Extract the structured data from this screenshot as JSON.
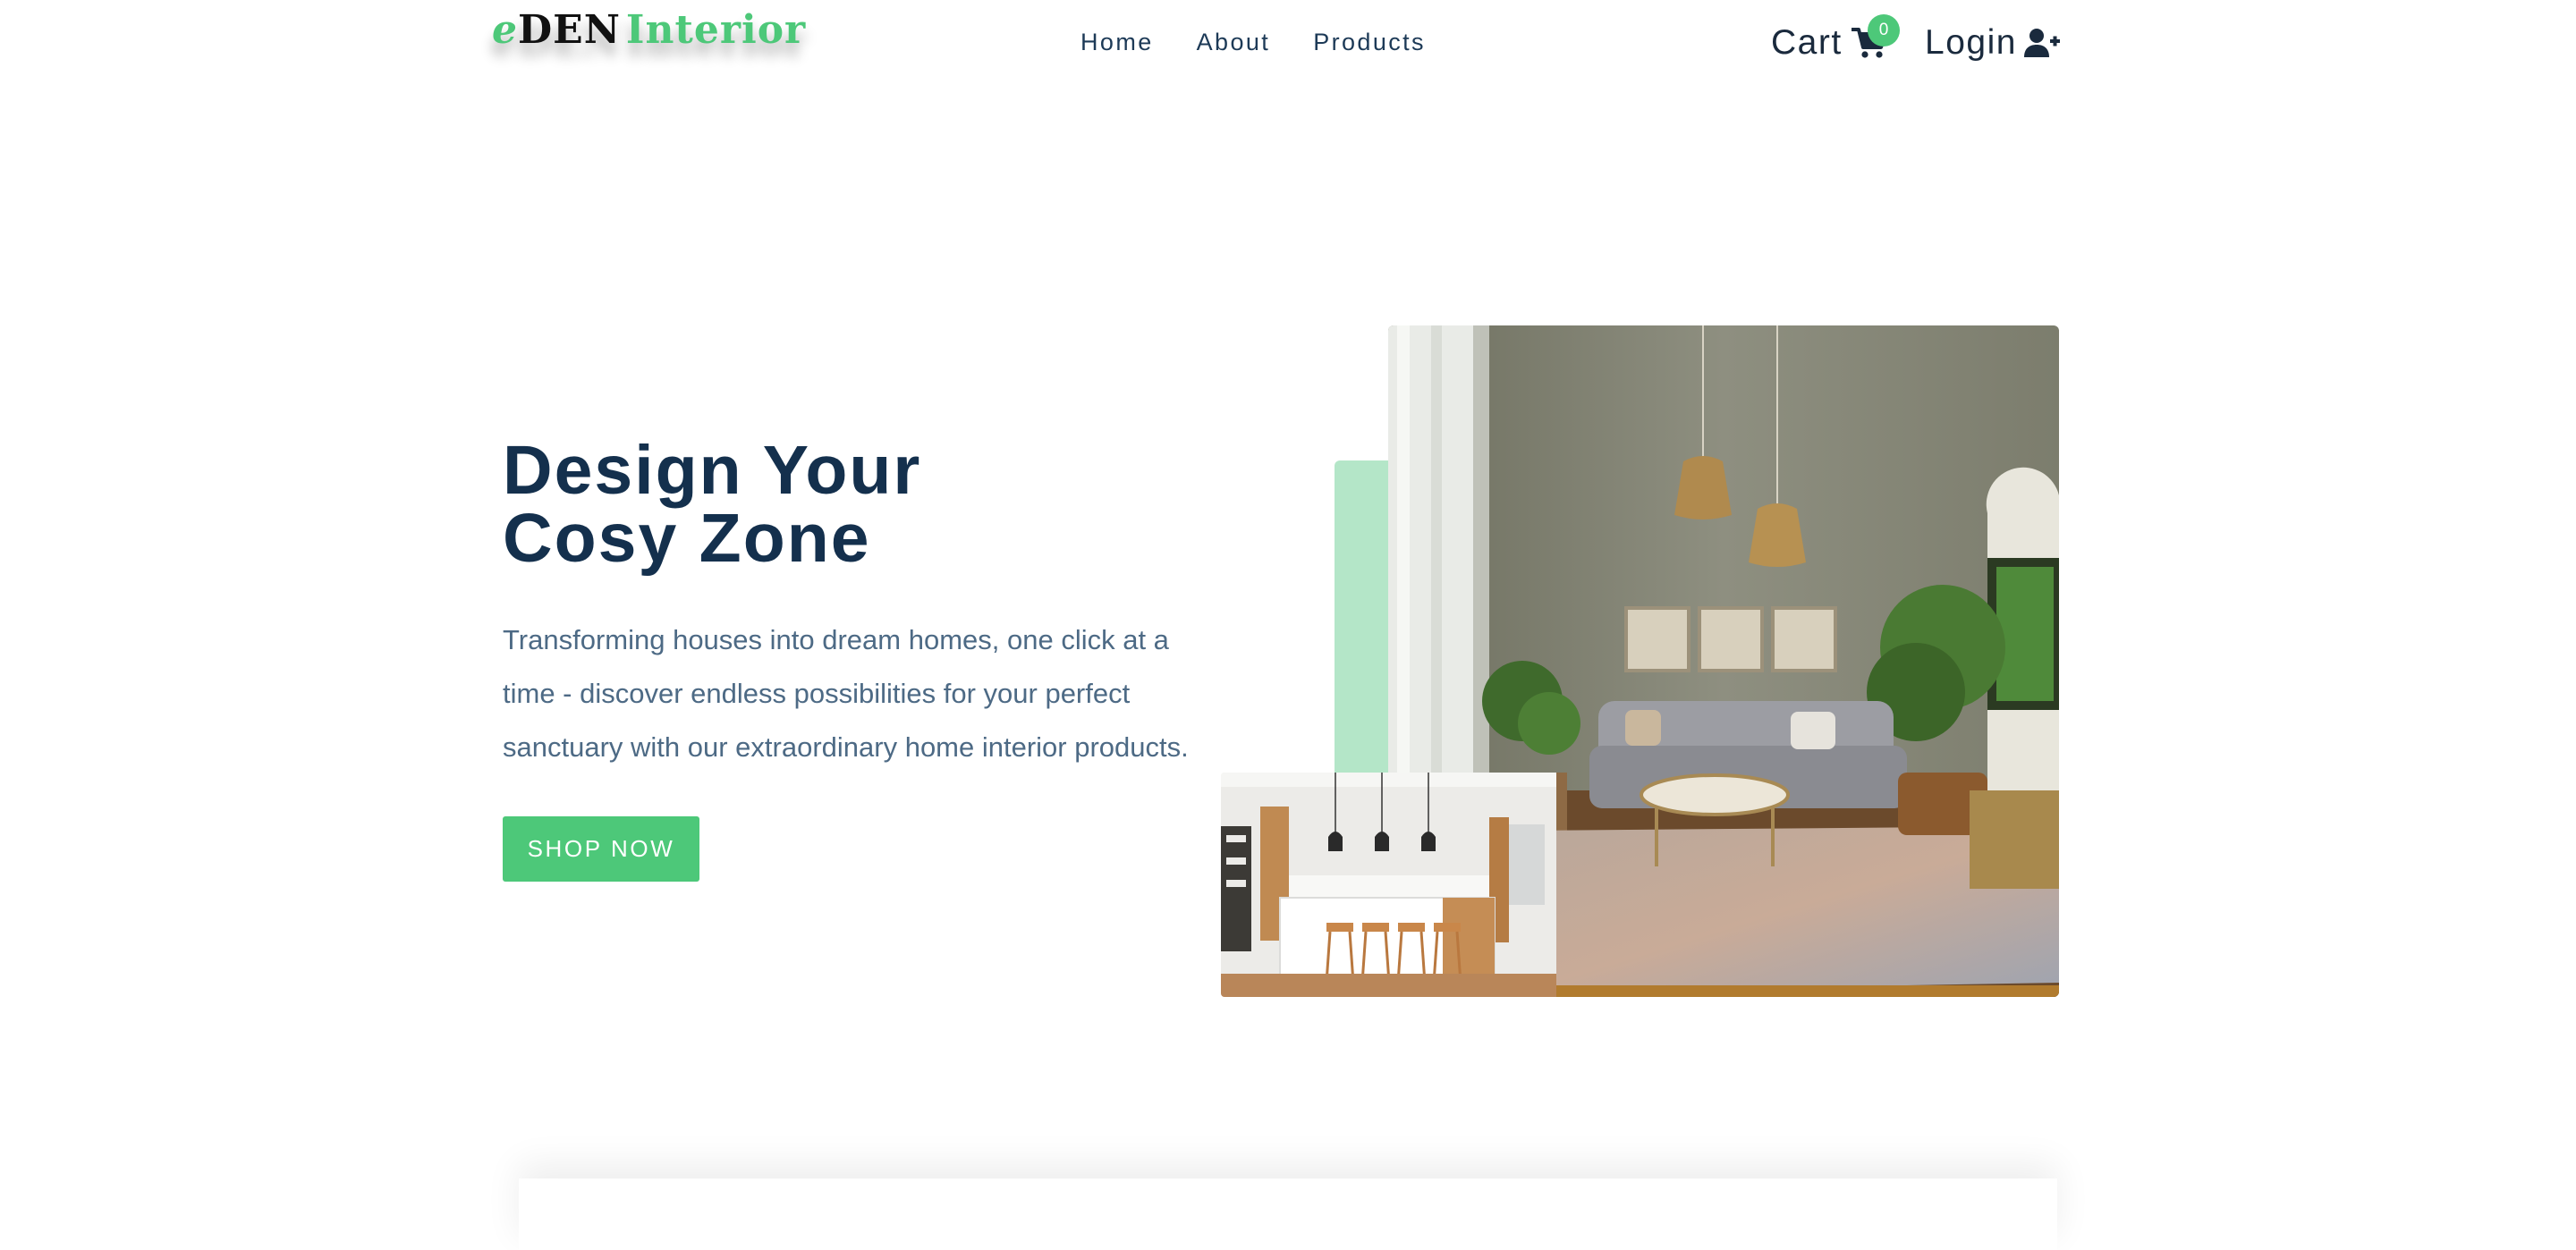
{
  "nav": {
    "logo": {
      "part1": "e",
      "part2": "DEN",
      "part3": "Interior"
    },
    "links": [
      "Home",
      "About",
      "Products"
    ],
    "cart": {
      "label": "Cart",
      "count": "0",
      "icon": "shopping-cart-icon"
    },
    "login": {
      "label": "Login",
      "icon": "user-plus-icon"
    }
  },
  "hero": {
    "title_line1": "Design Your",
    "title_line2": "Cosy Zone",
    "description": "Transforming houses into dream homes, one click at a time - discover endless possibilities for your perfect sanctuary with our extraordinary home interior products.",
    "cta": "SHOP NOW"
  },
  "colors": {
    "accent": "#4dc879",
    "accent_light": "#b4e6c8",
    "heading": "#14304d",
    "body_text": "#4d6a85"
  }
}
